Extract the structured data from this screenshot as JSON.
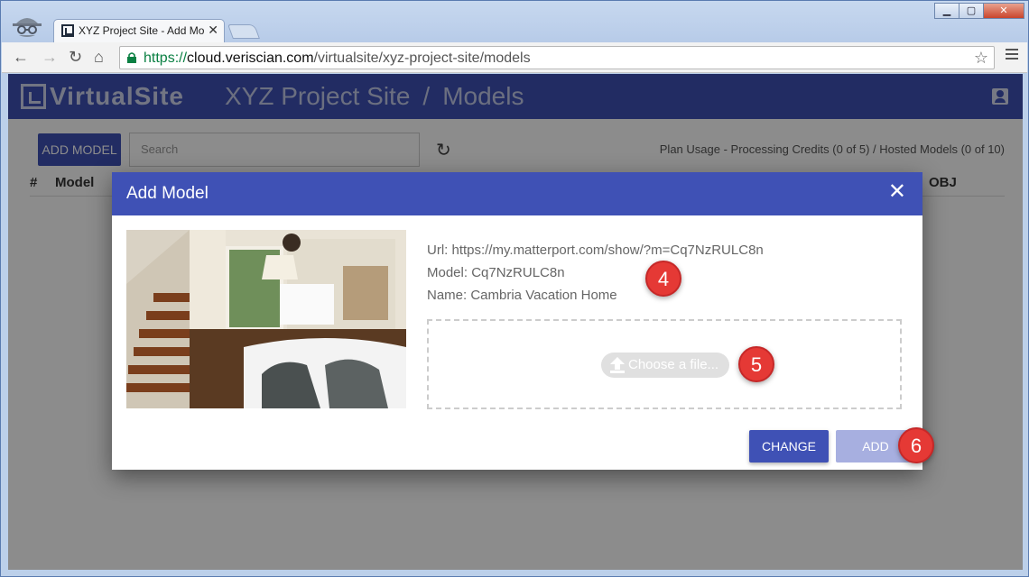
{
  "browser": {
    "tab_title": "XYZ Project Site - Add Mo",
    "tab_close": "✕",
    "url_scheme": "https://",
    "url_host": "cloud.veriscian.com",
    "url_path": "/virtualsite/xyz-project-site/models"
  },
  "app": {
    "logo_text": "VirtualSite",
    "breadcrumb_site": "XYZ Project Site",
    "breadcrumb_sep": "/",
    "breadcrumb_page": "Models",
    "add_model_label": "ADD MODEL",
    "search_placeholder": "Search",
    "plan_usage": "Plan Usage - Processing Credits (0 of 5) / Hosted Models (0 of 10)",
    "table_headers": {
      "num": "#",
      "model": "Model",
      "obj": "OBJ"
    }
  },
  "modal": {
    "title": "Add Model",
    "close": "✕",
    "url_line": "Url: https://my.matterport.com/show/?m=Cq7NzRULC8n",
    "model_line": "Model: Cq7NzRULC8n",
    "name_line": "Name: Cambria Vacation Home",
    "choose_file": "Choose a file...",
    "change_label": "CHANGE",
    "add_label": "ADD"
  },
  "callouts": [
    "4",
    "5",
    "6"
  ],
  "colors": {
    "primary": "#3f51b5",
    "add_disabled": "#a7afe0",
    "callout": "#e53935"
  }
}
